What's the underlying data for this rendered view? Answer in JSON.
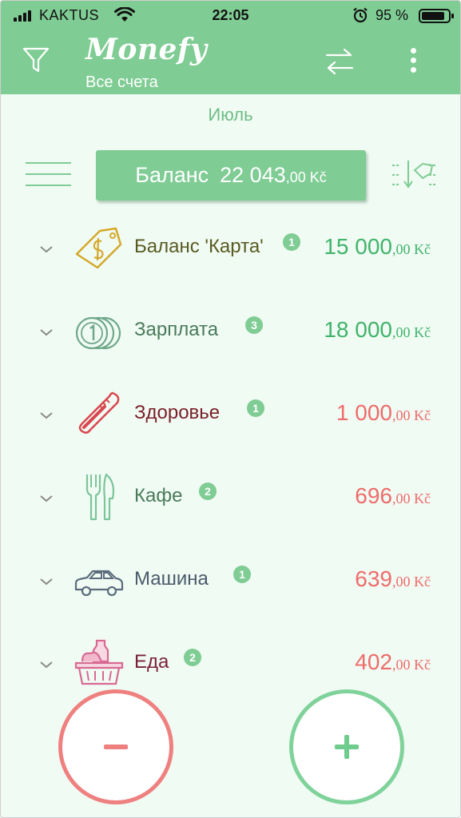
{
  "status_bar": {
    "carrier": "KAKTUS",
    "time": "22:05",
    "battery_percent": "95 %"
  },
  "app_bar": {
    "logo": "Monefy",
    "account": "Все счета"
  },
  "period": {
    "label": "Июль"
  },
  "balance": {
    "label": "Баланс",
    "amount_main": "22 043",
    "amount_cents": ",00 Kč"
  },
  "categories": [
    {
      "name": "Баланс 'Карта'",
      "badge": "1",
      "amount_main": "15 000",
      "amount_cents": ",00 Kč",
      "icon": "price-tag-dollar-icon",
      "type": "income",
      "name_color": "#5a5a22"
    },
    {
      "name": "Зарплата",
      "badge": "3",
      "amount_main": "18 000",
      "amount_cents": ",00 Kč",
      "icon": "coins-icon",
      "type": "income",
      "name_color": "#4a7a5a"
    },
    {
      "name": "Здоровье",
      "badge": "1",
      "amount_main": "1 000",
      "amount_cents": ",00 Kč",
      "icon": "thermometer-icon",
      "type": "expense",
      "name_color": "#7a1f2a"
    },
    {
      "name": "Кафе",
      "badge": "2",
      "amount_main": "696",
      "amount_cents": ",00 Kč",
      "icon": "fork-knife-icon",
      "type": "expense",
      "name_color": "#4a7a5a"
    },
    {
      "name": "Машина",
      "badge": "1",
      "amount_main": "639",
      "amount_cents": ",00 Kč",
      "icon": "car-icon",
      "type": "expense",
      "name_color": "#4a5a6a"
    },
    {
      "name": "Еда",
      "badge": "2",
      "amount_main": "402",
      "amount_cents": ",00 Kč",
      "icon": "groceries-basket-icon",
      "type": "expense",
      "name_color": "#7a1f3a"
    }
  ],
  "colors": {
    "header": "#7fcc94",
    "income": "#3fb46b",
    "expense": "#ef6b6b",
    "background": "#f0fbf3"
  }
}
